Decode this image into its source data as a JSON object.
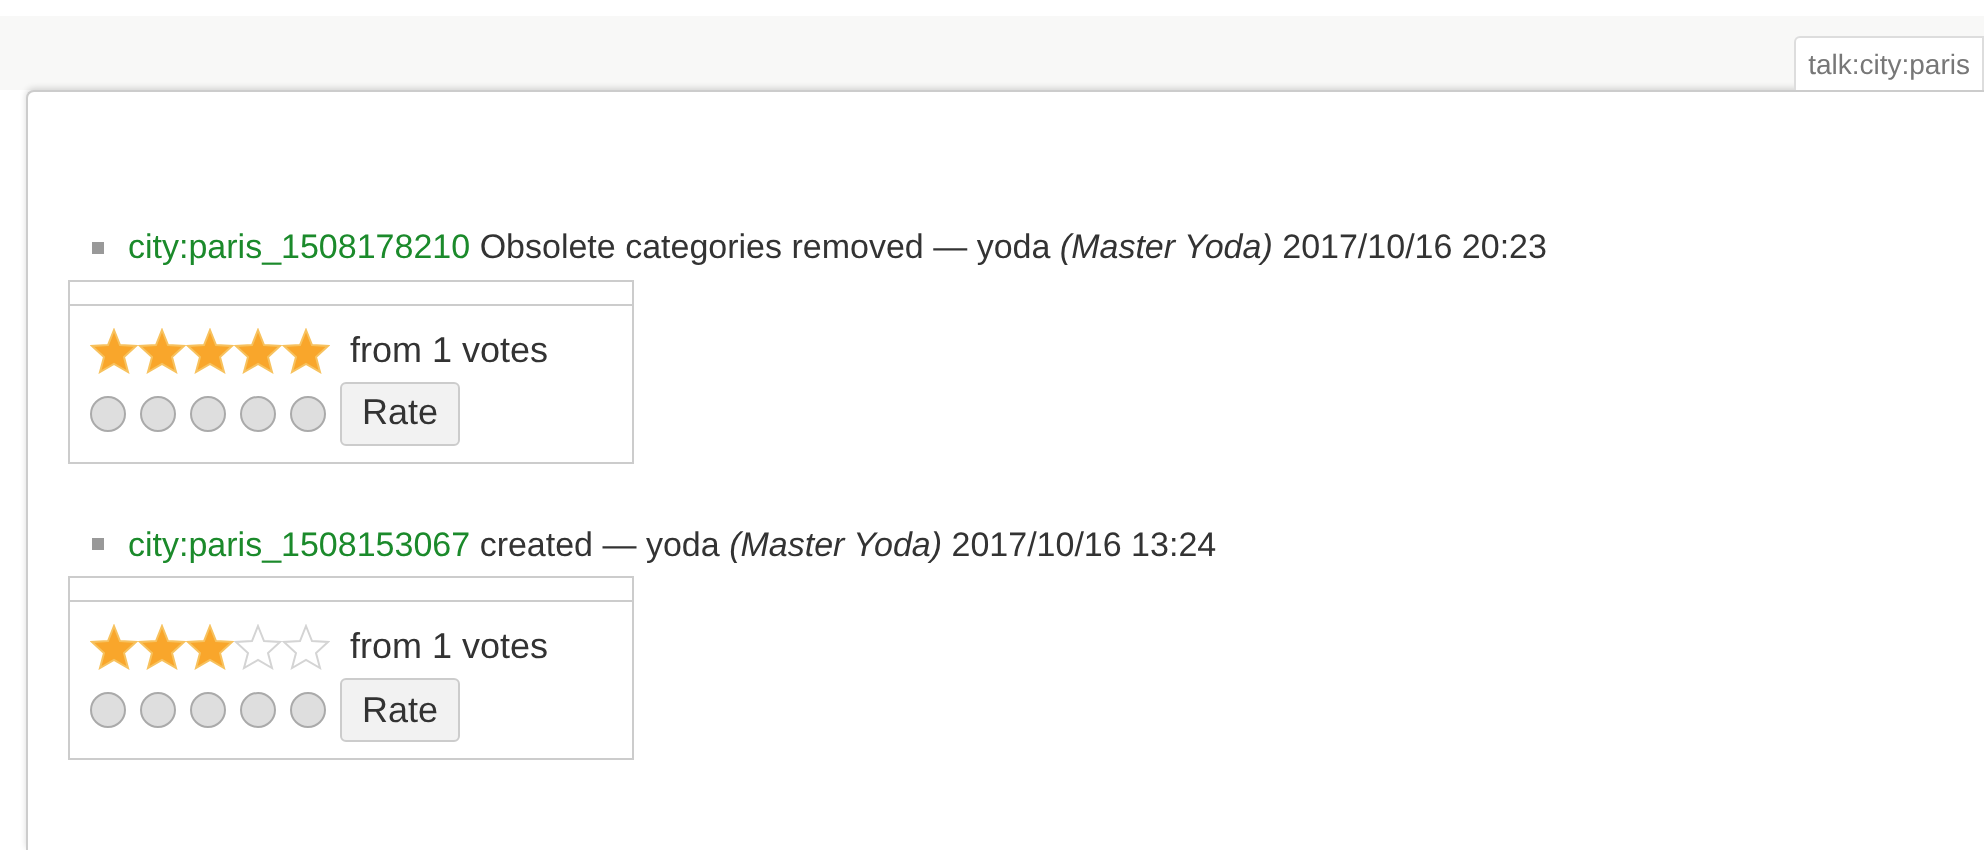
{
  "tab": {
    "label": "talk:city:paris"
  },
  "entries": [
    {
      "link": "city:paris_1508178210",
      "summary": "Obsolete categories removed — yoda *(Master Yoda)* 2017/10/16 20:23",
      "stars": 5,
      "votes": "from 1 votes",
      "radios": [
        {
          "selected": false
        },
        {
          "selected": false
        },
        {
          "selected": false
        },
        {
          "selected": false
        },
        {
          "selected": false
        }
      ],
      "button": "Rate"
    },
    {
      "link": "city:paris_1508153067",
      "summary": "created — yoda *(Master Yoda)* 2017/10/16 13:24",
      "stars": 3,
      "votes": "from 1 votes",
      "radios": [
        {
          "selected": false
        },
        {
          "selected": false
        },
        {
          "selected": false
        },
        {
          "selected": false
        },
        {
          "selected": false
        }
      ],
      "button": "Rate"
    }
  ]
}
